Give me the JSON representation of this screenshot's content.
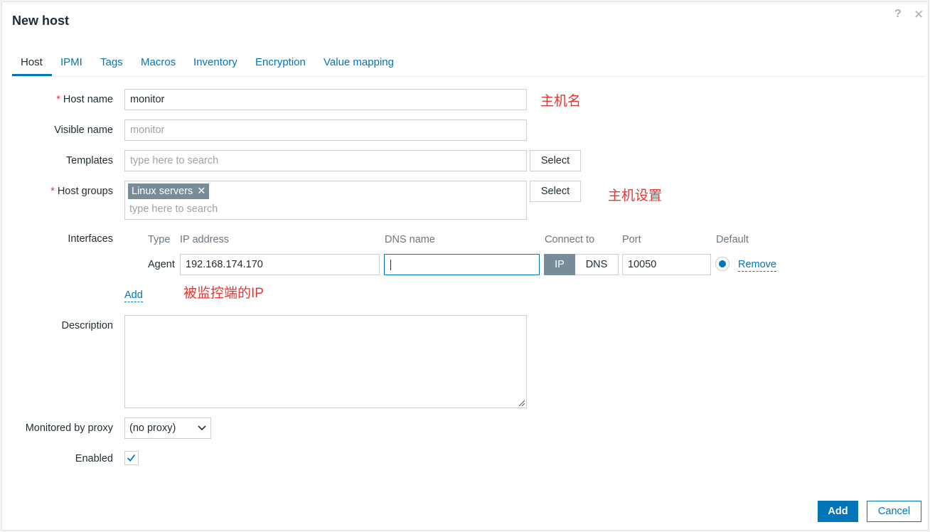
{
  "dialog": {
    "title": "New host",
    "help": "?",
    "close": "✕"
  },
  "tabs": [
    {
      "label": "Host"
    },
    {
      "label": "IPMI"
    },
    {
      "label": "Tags"
    },
    {
      "label": "Macros"
    },
    {
      "label": "Inventory"
    },
    {
      "label": "Encryption"
    },
    {
      "label": "Value mapping"
    }
  ],
  "form": {
    "required_mark": "*",
    "host_name": {
      "label": "Host name",
      "value": "monitor"
    },
    "visible_name": {
      "label": "Visible name",
      "placeholder": "monitor"
    },
    "templates": {
      "label": "Templates",
      "placeholder": "type here to search",
      "select": "Select"
    },
    "host_groups": {
      "label": "Host groups",
      "chip": "Linux servers",
      "chip_remove": "✕",
      "placeholder": "type here to search",
      "select": "Select"
    },
    "interfaces": {
      "label": "Interfaces",
      "headers": {
        "type": "Type",
        "ip": "IP address",
        "dns": "DNS name",
        "connect": "Connect to",
        "port": "Port",
        "default": "Default"
      },
      "row": {
        "type": "Agent",
        "ip": "192.168.174.170",
        "dns": "",
        "connect_ip": "IP",
        "connect_dns": "DNS",
        "port": "10050",
        "remove": "Remove"
      },
      "add": "Add"
    },
    "description": {
      "label": "Description",
      "value": ""
    },
    "proxy": {
      "label": "Monitored by proxy",
      "value": "(no proxy)"
    },
    "enabled": {
      "label": "Enabled",
      "checked": true
    }
  },
  "annotations": {
    "host_name": "主机名",
    "host_settings": "主机设置",
    "monitored_ip": "被监控端的IP"
  },
  "footer": {
    "add": "Add",
    "cancel": "Cancel"
  },
  "colors": {
    "accent": "#0275b8",
    "required": "#e33734",
    "annotation": "#e33734",
    "segment_active": "#768d99"
  }
}
